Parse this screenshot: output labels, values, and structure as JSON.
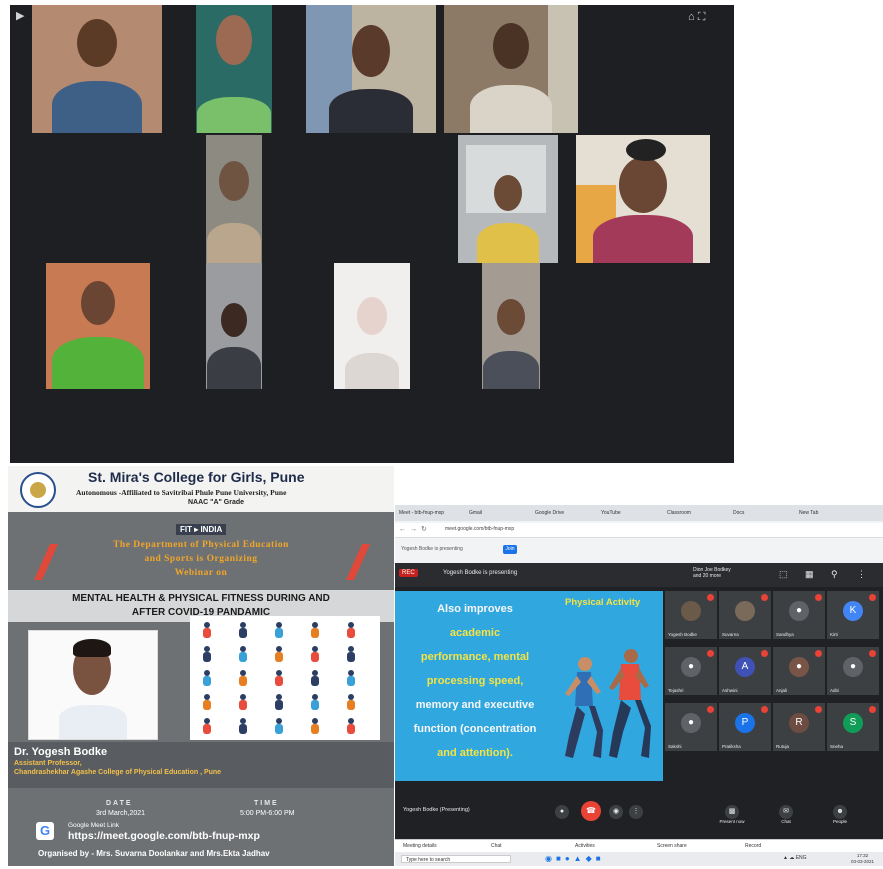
{
  "video_grid": {
    "top_icons": [
      "▶",
      "⌂ ⛶"
    ],
    "tiles": [
      {
        "name": "participant-1"
      },
      {
        "name": "participant-2"
      },
      {
        "name": "participant-3"
      },
      {
        "name": "participant-4"
      },
      {
        "name": "participant-5"
      },
      {
        "name": "participant-6"
      },
      {
        "name": "participant-7"
      },
      {
        "name": "participant-8"
      },
      {
        "name": "participant-9"
      },
      {
        "name": "participant-10"
      },
      {
        "name": "participant-11"
      },
      {
        "name": "participant-12"
      }
    ]
  },
  "poster": {
    "college": "St. Mira's College for Girls, Pune",
    "affiliation": "Autonomous -Affiliated to Savitribai Phule Pune University, Pune",
    "naac": "NAAC \"A\" Grade",
    "fit_logo": "FIT ▸ INDIA",
    "department_line1": "The Department of Physical Education",
    "department_line2": "and Sports is Organizing",
    "department_line3": "Webinar on",
    "topic_line1": "MENTAL HEALTH & PHYSICAL FITNESS DURING AND",
    "topic_line2": "AFTER COVID-19 PANDAMIC",
    "speaker_name": "Dr. Yogesh Bodke",
    "speaker_role": "Assistant Professor,",
    "speaker_institution": "Chandrashekhar Agashe College of Physical Education , Pune",
    "date_label": "DATE",
    "date_value": "3rd March,2021",
    "time_label": "TIME",
    "time_value": "5:00 PM-6:00 PM",
    "gmeet_label": "Google Meet Link",
    "gmeet_url": "https://meet.google.com/btb-fnup-mxp",
    "organised_by": "Organised by - Mrs. Suvarna Doolankar and Mrs.Ekta Jadhav",
    "colors": {
      "accent_orange": "#f0a628",
      "stripe_red": "#e0483a",
      "text_yellow": "#f2c04a"
    }
  },
  "browser": {
    "tabs": [
      "Meet - btb-fnup-mxp",
      "Gmail",
      "Google Drive",
      "YouTube",
      "Classroom",
      "Docs",
      "New Tab"
    ],
    "url": "meet.google.com/btb-fnup-mxp",
    "ext_chip": "Yogesh Bodke is presenting",
    "ext_button": "Join",
    "meet": {
      "rec_label": "REC",
      "presenting": "Yogesh Bodke is presenting",
      "people_line1": "Dion Joe Bodkey",
      "people_line2": "and 20 more",
      "meeting_info": "Yogesh Bodke (Presenting)",
      "control_labels": [
        "Mic",
        "Camera",
        "Present now",
        "Chat",
        "People"
      ],
      "slide": {
        "heading": "Physical Activity",
        "lines": [
          {
            "text": "Also improves",
            "color": "#f7f7f7"
          },
          {
            "text": "academic",
            "color": "#f5e342"
          },
          {
            "text": "performance, mental",
            "color": "#f5e342"
          },
          {
            "text": "processing speed,",
            "color": "#f5e342"
          },
          {
            "text": "memory and executive",
            "color": "#f7f7f7"
          },
          {
            "text": "function (concentration",
            "color": "#f7f7f7"
          },
          {
            "text": "and attention).",
            "color": "#f5e342"
          }
        ]
      },
      "participants": [
        {
          "name": "Yogesh Bodke",
          "initial": "",
          "color": "#6b5a4a"
        },
        {
          "name": "Suvarna",
          "initial": "",
          "color": "#7a6a5a"
        },
        {
          "name": "Sandhya",
          "initial": "●",
          "color": "#5f6368"
        },
        {
          "name": "Kirti",
          "initial": "K",
          "color": "#4285f4"
        },
        {
          "name": "Tejashri",
          "initial": "●",
          "color": "#5f6368"
        },
        {
          "name": "Ashwini",
          "initial": "A",
          "color": "#3f51b5"
        },
        {
          "name": "Anjali",
          "initial": "●",
          "color": "#795548"
        },
        {
          "name": "Aditi",
          "initial": "●",
          "color": "#5f6368"
        },
        {
          "name": "Sakshi",
          "initial": "●",
          "color": "#5f6368"
        },
        {
          "name": "Pratiksha",
          "initial": "P",
          "color": "#1a73e8"
        },
        {
          "name": "Rutuja",
          "initial": "R",
          "color": "#6d4c41"
        },
        {
          "name": "Sneha",
          "initial": "S",
          "color": "#0f9d58"
        }
      ]
    },
    "docbar_items": [
      "Meeting details",
      "Chat",
      "Activities",
      "Screen share",
      "Record"
    ],
    "taskbar": {
      "search_placeholder": "Type here to search",
      "tray": "▲ ☁ ENG",
      "time": "17:32",
      "date": "03-03-2021"
    }
  }
}
